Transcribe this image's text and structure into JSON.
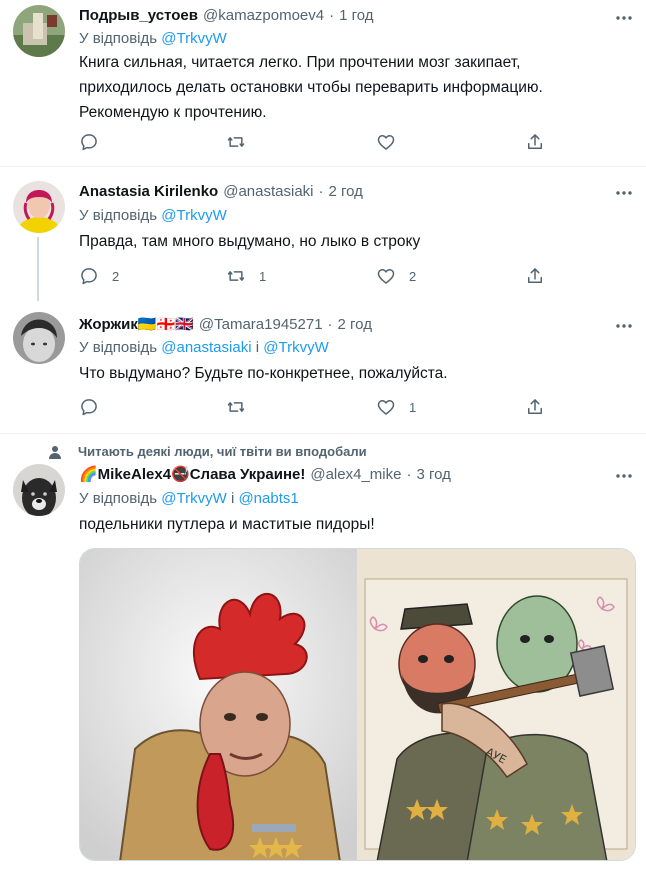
{
  "tweets": [
    {
      "name": "Подрыв_устоев",
      "handle": "@kamazpomoev4",
      "time": "1 год",
      "reply_prefix": "У відповідь",
      "reply_to": [
        "@TrkvyW"
      ],
      "text_lines": [
        "Книга сильная, читается легко. При прочтении мозг закипает,",
        "приходилось делать остановки чтобы переварить информацию.",
        "Рекомендую к прочтению."
      ],
      "replies": "",
      "retweets": "",
      "likes": ""
    },
    {
      "name": "Anastasia Kirilenko",
      "handle": "@anastasiaki",
      "time": "2 год",
      "reply_prefix": "У відповідь",
      "reply_to": [
        "@TrkvyW"
      ],
      "text_lines": [
        "Правда, там много выдумано, но лыко в строку"
      ],
      "replies": "2",
      "retweets": "1",
      "likes": "2"
    },
    {
      "name": "Жоржик🇺🇦🇬🇪🇬🇧",
      "handle": "@Tamara1945271",
      "time": "2 год",
      "reply_prefix": "У відповідь",
      "reply_to": [
        "@anastasiaki",
        "@TrkvyW"
      ],
      "reply_joiner": "і",
      "text_lines": [
        "Что выдумано? Будьте по-конкретнее, пожалуйста."
      ],
      "replies": "",
      "retweets": "",
      "likes": "1"
    },
    {
      "social_context": "Читають деякі люди, чиї твіти ви вподобали",
      "name": "🌈MikeAlex4🚭Слава Украине!",
      "handle": "@alex4_mike",
      "time": "3 год",
      "reply_prefix": "У відповідь",
      "reply_to": [
        "@TrkvyW",
        "@nabts1"
      ],
      "reply_joiner": "і",
      "text_lines": [
        "подельники путлера и маститые пидоры!"
      ]
    }
  ],
  "icons": {
    "reply": "reply-icon",
    "retweet": "retweet-icon",
    "like": "heart-icon",
    "share": "share-icon",
    "more": "more-icon"
  },
  "colors": {
    "link": "#1d9bf0",
    "secondary": "#536471",
    "text": "#0f1419",
    "divider": "#eff3f4"
  },
  "labels": {
    "text_aue": "АУЕ"
  }
}
